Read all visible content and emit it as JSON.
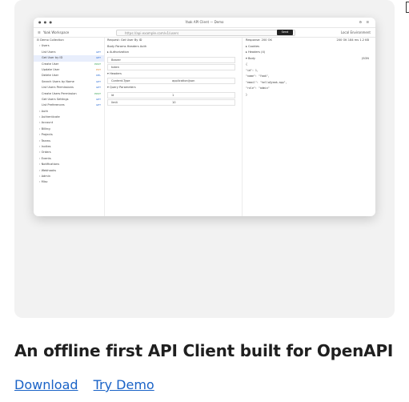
{
  "app": {
    "window_title": "Yaak API Client — Demo"
  },
  "toolbar": {
    "workspace": "Yaak Workspace",
    "url_placeholder": "https://api.example.com/v1/users",
    "send_label": "Send",
    "environment": "Local Environment"
  },
  "sidebar": {
    "items": [
      {
        "label": "Demo Collection",
        "level": 0
      },
      {
        "label": "Users",
        "level": 1
      },
      {
        "label": "List Users",
        "level": 2,
        "method": "GET"
      },
      {
        "label": "Get User by ID",
        "level": 2,
        "method": "GET",
        "active": true
      },
      {
        "label": "Create User",
        "level": 2,
        "method": "POST"
      },
      {
        "label": "Update User",
        "level": 2,
        "method": "PUT"
      },
      {
        "label": "Delete User",
        "level": 2,
        "method": "DEL"
      },
      {
        "label": "Search Users by Name",
        "level": 2,
        "method": "GET"
      },
      {
        "label": "List Users Permissions",
        "level": 2,
        "method": "GET"
      },
      {
        "label": "Create Users Permission",
        "level": 2,
        "method": "POST"
      },
      {
        "label": "Get Users Settings",
        "level": 2,
        "method": "GET"
      },
      {
        "label": "List Preferences",
        "level": 2,
        "method": "GET"
      },
      {
        "label": "Auth",
        "level": 1
      },
      {
        "label": "Authenticate",
        "level": 1
      },
      {
        "label": "Account",
        "level": 1
      },
      {
        "label": "Billing",
        "level": 1
      },
      {
        "label": "Projects",
        "level": 1
      },
      {
        "label": "Teams",
        "level": 1
      },
      {
        "label": "Invites",
        "level": 1
      },
      {
        "label": "Orders",
        "level": 1
      },
      {
        "label": "Events",
        "level": 1
      },
      {
        "label": "Notifications",
        "level": 1
      },
      {
        "label": "Webhooks",
        "level": 1
      },
      {
        "label": "Admin",
        "level": 1
      },
      {
        "label": "Misc",
        "level": 1
      }
    ]
  },
  "request": {
    "title": "Request: Get User By ID",
    "tabs": "Body  Params  Headers  Auth",
    "auth_header": "Authorization",
    "auth_type": "Bearer",
    "auth_value": "token",
    "headers_section": "Headers",
    "header_key": "Content-Type",
    "header_value": "application/json",
    "query_section": "Query Parameters",
    "param_key": "id",
    "param_value": "1",
    "param2_key": "limit",
    "param2_value": "10"
  },
  "response": {
    "title": "Response: 200 OK",
    "meta": "200 OK  184 ms  1.2 KB",
    "cookies": "Cookies",
    "headers": "Headers (4)",
    "body_label": "Body",
    "format": "JSON",
    "code_lines": [
      "{",
      "  \"id\": 1,",
      "  \"name\": \"Yaak\",",
      "  \"email\": \"hello@yaak.app\",",
      "  \"role\": \"admin\"",
      "}"
    ]
  },
  "caption": "An offline first API Client built for OpenAPI",
  "links": {
    "download": "Download",
    "demo": "Try Demo"
  }
}
